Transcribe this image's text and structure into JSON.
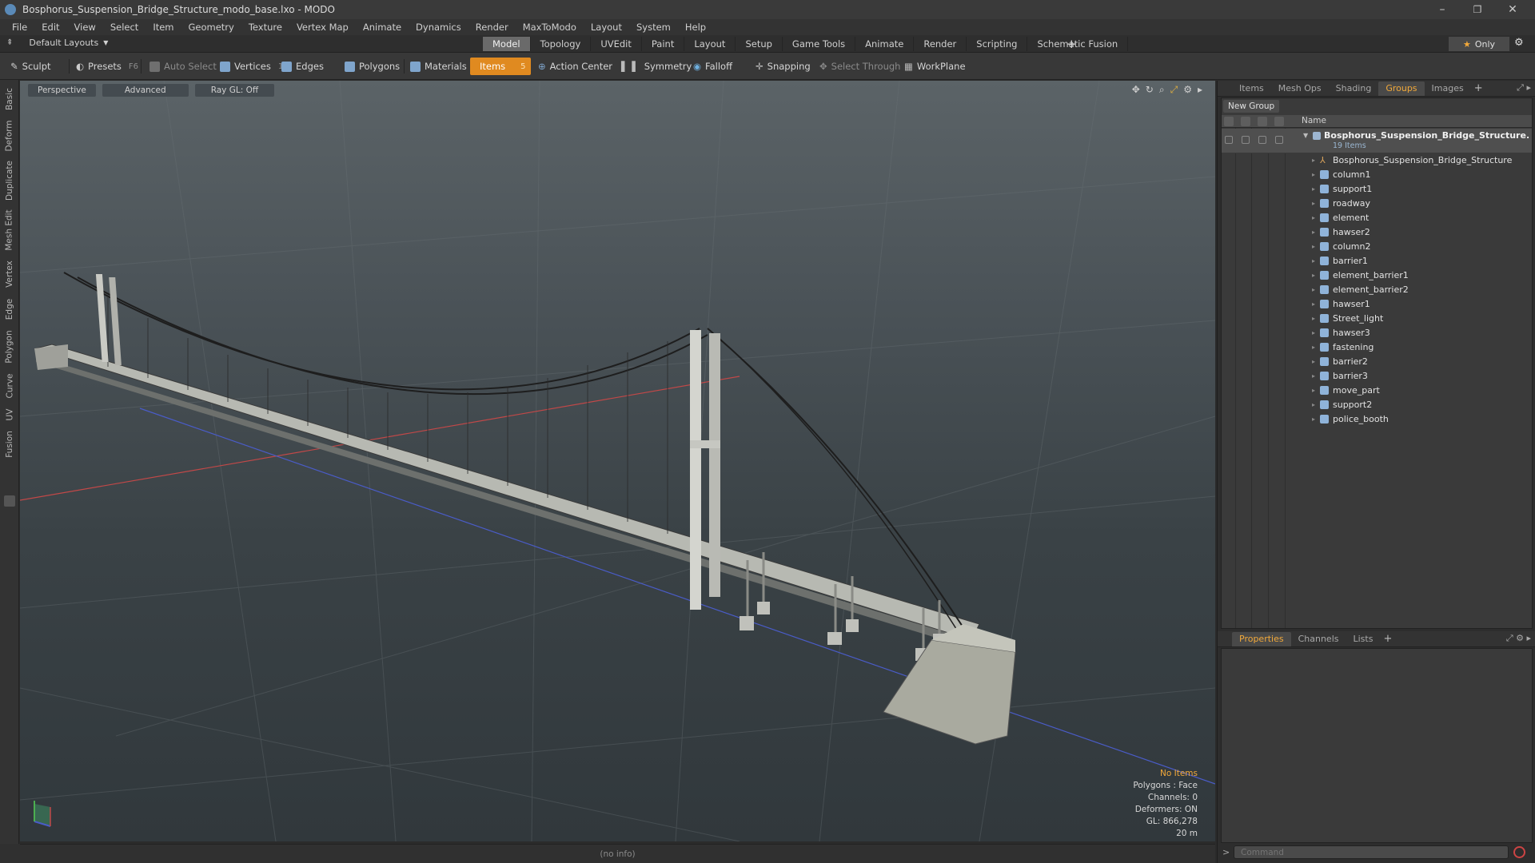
{
  "window": {
    "title": "Bosphorus_Suspension_Bridge_Structure_modo_base.lxo - MODO",
    "minimize": "–",
    "maximize": "❐",
    "close": "✕"
  },
  "menu": [
    "File",
    "Edit",
    "View",
    "Select",
    "Item",
    "Geometry",
    "Texture",
    "Vertex Map",
    "Animate",
    "Dynamics",
    "Render",
    "MaxToModo",
    "Layout",
    "System",
    "Help"
  ],
  "layout_bar": {
    "layout_select": "Default Layouts",
    "tabs": [
      "Model",
      "Topology",
      "UVEdit",
      "Paint",
      "Layout",
      "Setup",
      "Game Tools",
      "Animate",
      "Render",
      "Scripting",
      "Schematic Fusion"
    ],
    "active_tab": "Model",
    "add": "+",
    "only_label": "Only"
  },
  "toolbar": {
    "sculpt": "Sculpt",
    "presets": "Presets",
    "presets_key": "F6",
    "auto_select": "Auto Select",
    "vertices": "Vertices",
    "vertices_key": "1",
    "edges": "Edges",
    "edges_key": "2",
    "polygons": "Polygons",
    "materials": "Materials",
    "items": "Items",
    "items_key": "5",
    "action_center": "Action Center",
    "symmetry": "Symmetry",
    "falloff": "Falloff",
    "snapping": "Snapping",
    "select_through": "Select Through",
    "workplane": "WorkPlane"
  },
  "left_tabs": [
    "Basic",
    "Deform",
    "Duplicate",
    "Mesh Edit",
    "Vertex",
    "Edge",
    "Polygon",
    "Curve",
    "UV",
    "Fusion"
  ],
  "viewport": {
    "view_mode": "Perspective",
    "shading": "Advanced",
    "ray_gl": "Ray GL: Off",
    "info": {
      "selection": "No Items",
      "polygons": "Polygons : Face",
      "channels": "Channels: 0",
      "deformers": "Deformers: ON",
      "gl": "GL: 866,278",
      "scale": "20 m"
    }
  },
  "statusbar": "(no info)",
  "right_panel": {
    "top_tabs": [
      "Items",
      "Mesh Ops",
      "Shading",
      "Groups",
      "Images"
    ],
    "active_top_tab": "Groups",
    "new_group": "New Group",
    "column_name": "Name",
    "group": {
      "name": "Bosphorus_Suspension_Bridge_Structure...",
      "count": "19 Items"
    },
    "items": [
      {
        "label": "Bosphorus_Suspension_Bridge_Structure",
        "icon": "locator-icon"
      },
      {
        "label": "column1",
        "icon": "mesh-icon"
      },
      {
        "label": "support1",
        "icon": "mesh-icon"
      },
      {
        "label": "roadway",
        "icon": "mesh-icon"
      },
      {
        "label": "element",
        "icon": "mesh-icon"
      },
      {
        "label": "hawser2",
        "icon": "mesh-icon"
      },
      {
        "label": "column2",
        "icon": "mesh-icon"
      },
      {
        "label": "barrier1",
        "icon": "mesh-icon"
      },
      {
        "label": "element_barrier1",
        "icon": "mesh-icon"
      },
      {
        "label": "element_barrier2",
        "icon": "mesh-icon"
      },
      {
        "label": "hawser1",
        "icon": "mesh-icon"
      },
      {
        "label": "Street_light",
        "icon": "mesh-icon"
      },
      {
        "label": "hawser3",
        "icon": "mesh-icon"
      },
      {
        "label": "fastening",
        "icon": "mesh-icon"
      },
      {
        "label": "barrier2",
        "icon": "mesh-icon"
      },
      {
        "label": "barrier3",
        "icon": "mesh-icon"
      },
      {
        "label": "move_part",
        "icon": "mesh-icon"
      },
      {
        "label": "support2",
        "icon": "mesh-icon"
      },
      {
        "label": "police_booth",
        "icon": "mesh-icon"
      }
    ],
    "bottom_tabs": [
      "Properties",
      "Channels",
      "Lists"
    ],
    "active_bottom_tab": "Properties",
    "command_placeholder": "Command"
  },
  "colors": {
    "accent": "#f2a93a",
    "active_tool": "#e08a20",
    "viewport_top": "#5b6367",
    "viewport_bottom": "#31383c"
  }
}
